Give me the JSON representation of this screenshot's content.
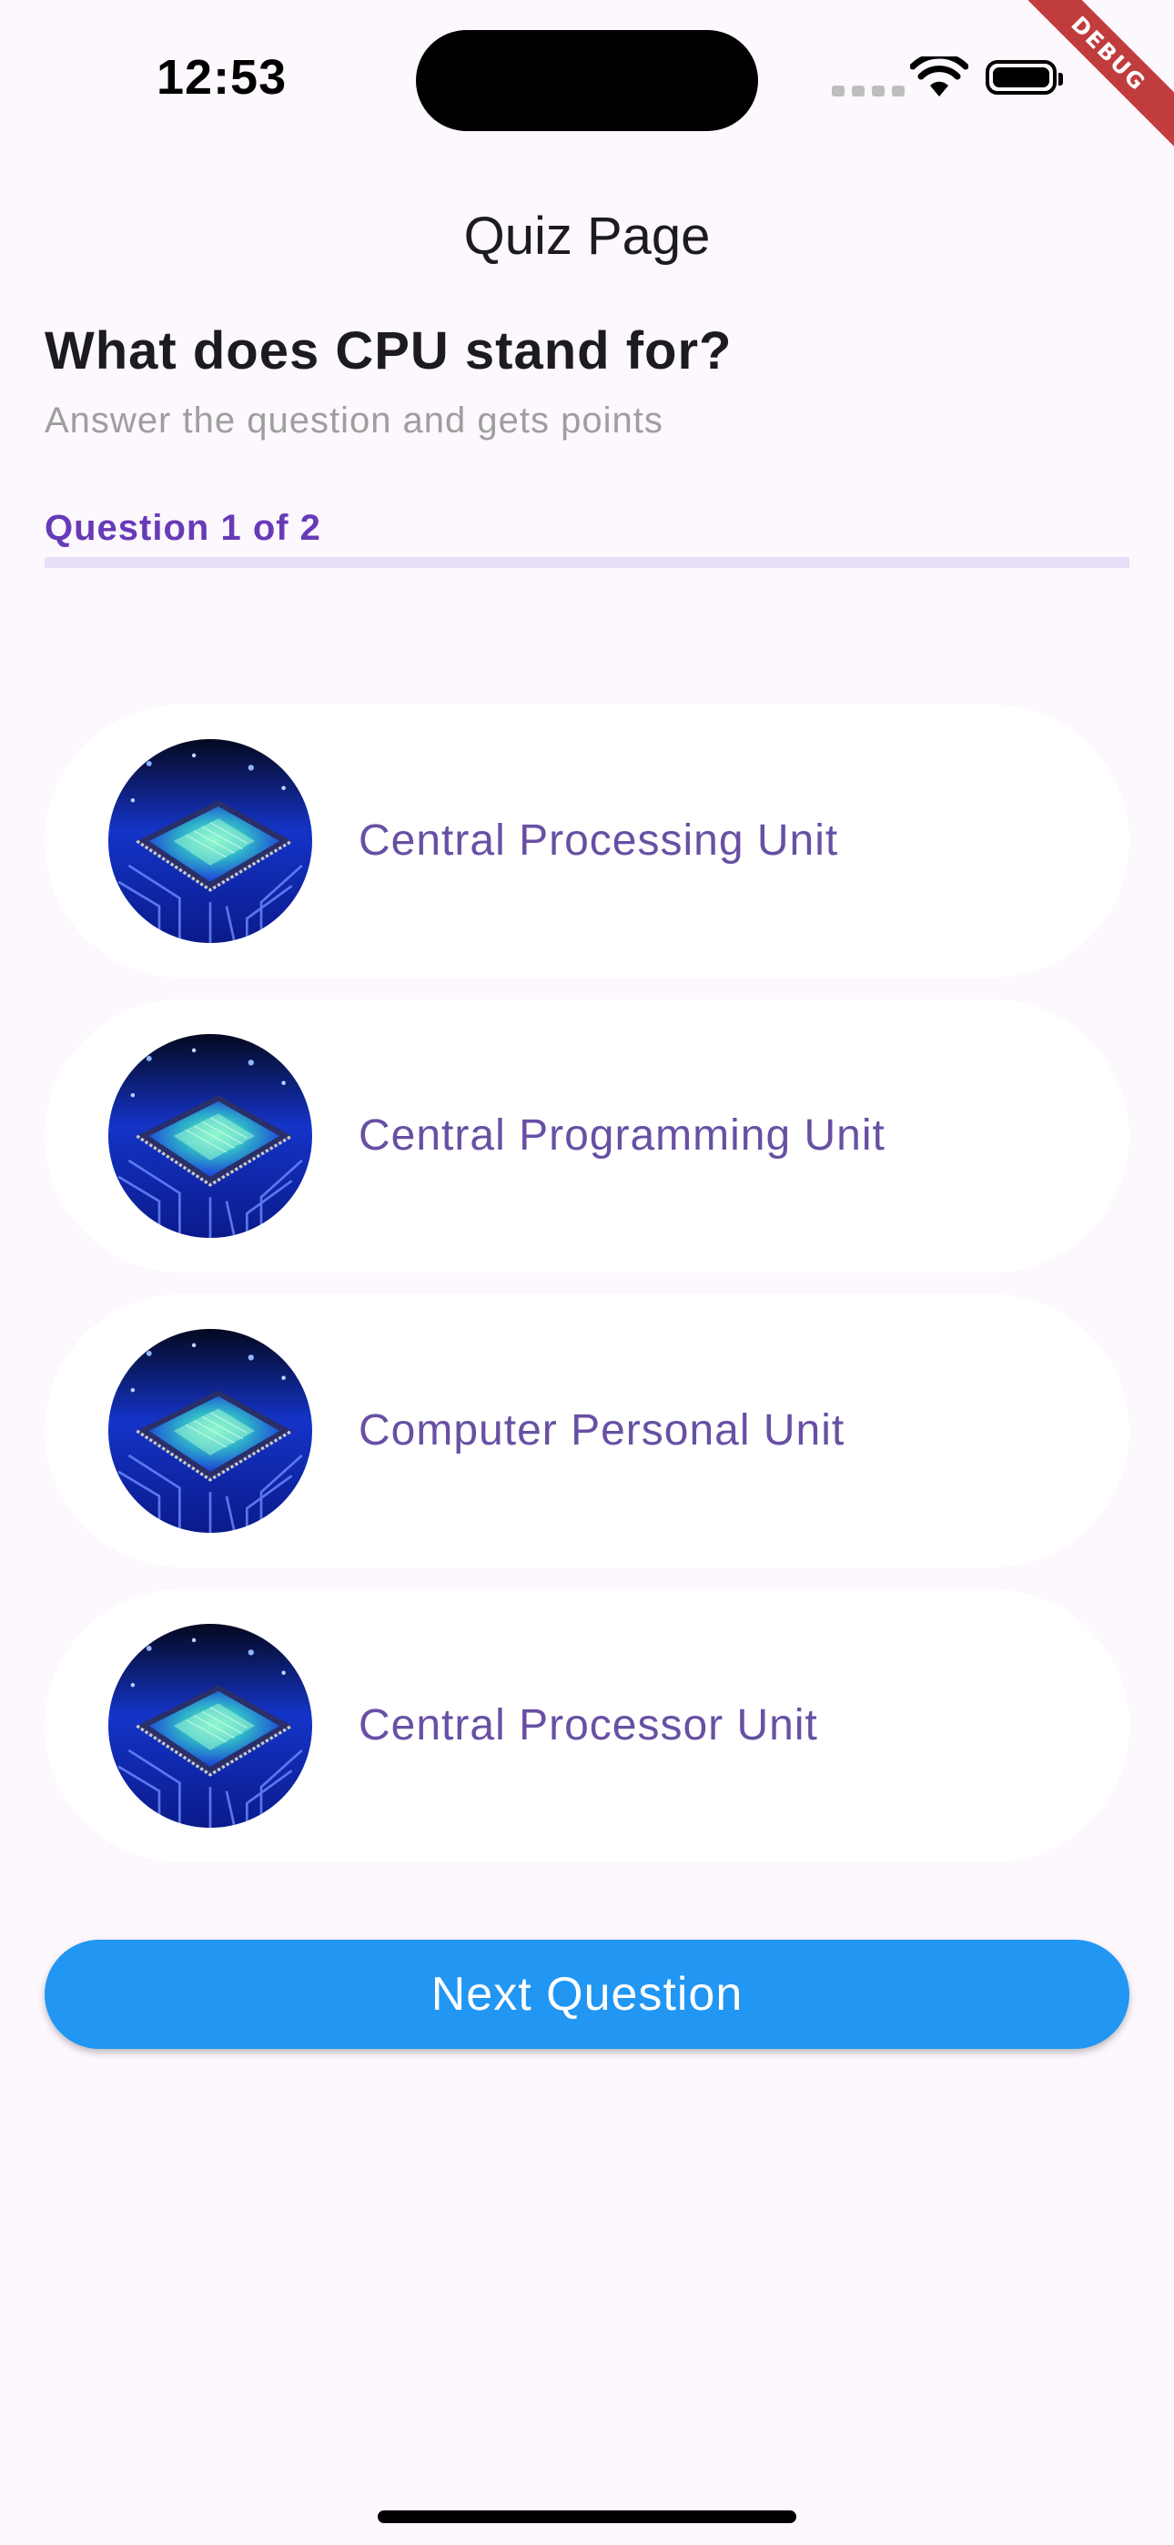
{
  "status_bar": {
    "time": "12:53",
    "icons": [
      "cellular-signal-icon",
      "wifi-icon",
      "battery-icon"
    ]
  },
  "debug_banner": "DEBUG",
  "app_bar": {
    "title": "Quiz Page"
  },
  "question": {
    "text": "What does CPU stand for?",
    "subtitle": "Answer the question and gets points"
  },
  "progress": {
    "label": "Question 1 of 2",
    "value": 0,
    "track_color": "#e8def8",
    "fill_color": "#673ab7"
  },
  "options": [
    {
      "label": "Central Processing Unit",
      "icon": "cpu-chip-image"
    },
    {
      "label": "Central Programming Unit",
      "icon": "cpu-chip-image"
    },
    {
      "label": "Computer Personal Unit",
      "icon": "cpu-chip-image"
    },
    {
      "label": "Central Processor Unit",
      "icon": "cpu-chip-image"
    }
  ],
  "next_button": {
    "label": "Next Question",
    "color": "#2196f3"
  },
  "colors": {
    "background": "#fdf7fe",
    "option_text": "#6750a4",
    "accent": "#673ab7"
  }
}
